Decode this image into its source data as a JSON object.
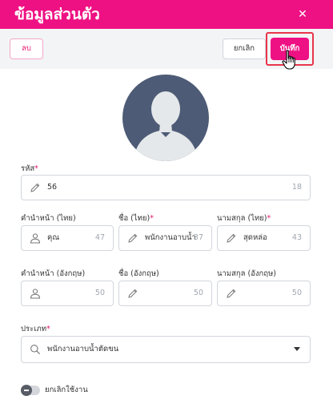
{
  "header": {
    "title": "ข้อมูลส่วนตัว",
    "close_icon": "close-icon"
  },
  "toolbar": {
    "delete_label": "ลบ",
    "cancel_label": "ยกเลิก",
    "save_label": "บันทึก"
  },
  "form": {
    "code": {
      "label": "รหัส",
      "value": "56",
      "counter": "18"
    },
    "prefix_th": {
      "label": "คำนำหน้า (ไทย)",
      "value": "คุณ",
      "counter": "47"
    },
    "firstname_th": {
      "label": "ชื่อ (ไทย)",
      "value": "พนักงานอาบน้ำ",
      "counter": "37"
    },
    "lastname_th": {
      "label": "นามสกุล (ไทย)",
      "value": "สุดหล่อ",
      "counter": "43"
    },
    "prefix_en": {
      "label": "คำนำหน้า (อังกฤษ)",
      "value": "",
      "counter": "50"
    },
    "firstname_en": {
      "label": "ชื่อ (อังกฤษ)",
      "value": "",
      "counter": "50"
    },
    "lastname_en": {
      "label": "นามสกุล (อังกฤษ)",
      "value": "",
      "counter": "50"
    },
    "type": {
      "label": "ประเภท",
      "value": "พนักงานอาบน้ำตัดขน"
    },
    "required_mark": "*"
  },
  "toggle": {
    "label": "ยกเลิกใช้งาน",
    "checked": false
  },
  "colors": {
    "brand": "#ee1183",
    "highlight": "#e8364a",
    "avatar_bg": "#4e5b76",
    "avatar_fg": "#e4e8ea"
  }
}
